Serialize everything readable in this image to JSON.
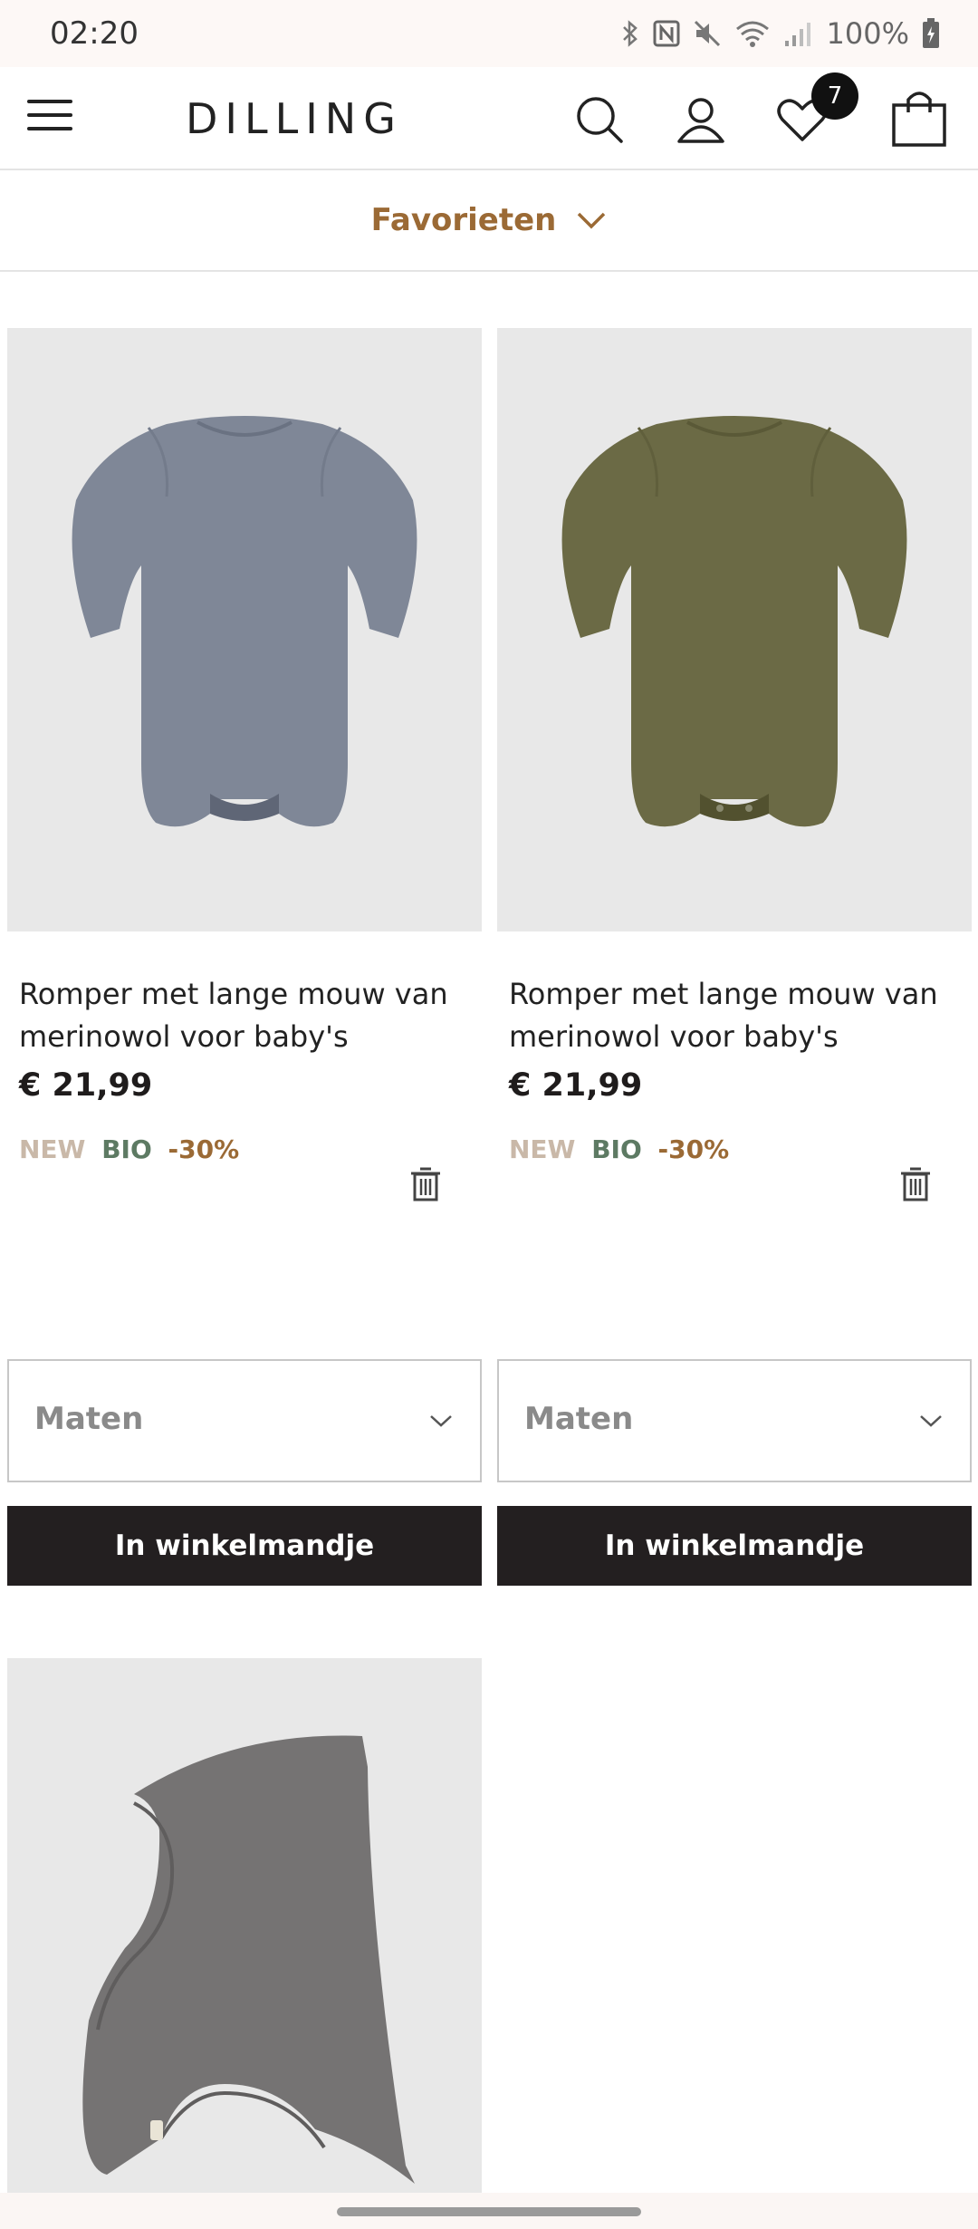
{
  "status_bar": {
    "time": "02:20",
    "battery": "100%",
    "icons": [
      "bluetooth-icon",
      "nfc-icon",
      "mute-icon",
      "wifi-icon",
      "signal-icon",
      "battery-icon"
    ]
  },
  "header": {
    "logo": "DILLING",
    "icons": [
      "menu-icon",
      "search-icon",
      "account-icon",
      "heart-icon",
      "bag-icon"
    ],
    "wishlist_count": "7"
  },
  "favorites": {
    "label": "Favorieten"
  },
  "products": [
    {
      "name": "Romper met lange mouw van merinowol voor baby's",
      "price": "€ 21,99",
      "badges": {
        "new": "NEW",
        "bio": "BIO",
        "discount": "-30%"
      },
      "size_placeholder": "Maten",
      "cart_label": "In winkelmandje",
      "color": "#7f8797"
    },
    {
      "name": "Romper met lange mouw van merinowol voor baby's",
      "price": "€ 21,99",
      "badges": {
        "new": "NEW",
        "bio": "BIO",
        "discount": "-30%"
      },
      "size_placeholder": "Maten",
      "cart_label": "In winkelmandje",
      "color": "#6b6a45"
    },
    {
      "color": "#757373"
    }
  ],
  "colors": {
    "accent": "#9b6a35",
    "badge_new": "#c9b8a8",
    "badge_bio": "#5d7a63",
    "badge_discount": "#9b6a35",
    "button_bg": "#231f20"
  }
}
